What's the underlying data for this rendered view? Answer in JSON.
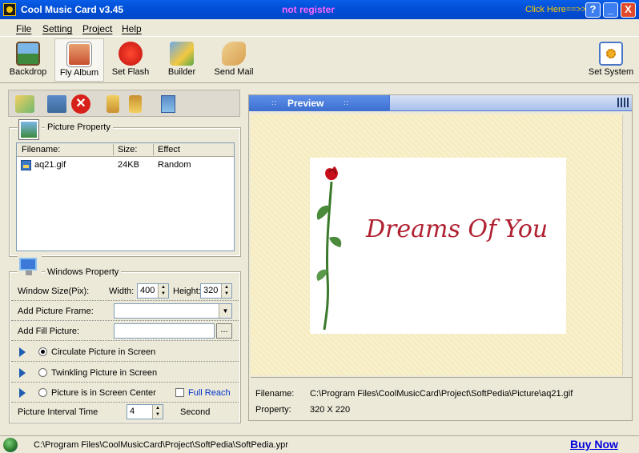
{
  "window": {
    "title": "Cool Music Card v3.45",
    "register_status": "not register",
    "click_here": "Click Here==>>",
    "help_btn": "?",
    "min_btn": "_",
    "close_btn": "X"
  },
  "menu": {
    "items": [
      {
        "label": "File"
      },
      {
        "label": "Setting"
      },
      {
        "label": "Project"
      },
      {
        "label": "Help"
      }
    ]
  },
  "toolbar": {
    "items": [
      {
        "label": "Backdrop",
        "icon": "landscape-picture-icon"
      },
      {
        "label": "Fly Album",
        "icon": "album-icon",
        "active": true
      },
      {
        "label": "Set Flash",
        "icon": "flash-icon"
      },
      {
        "label": "Builder",
        "icon": "builder-icon"
      },
      {
        "label": "Send Mail",
        "icon": "handshake-mail-icon"
      }
    ],
    "set_system_label": "Set System"
  },
  "picture_property": {
    "title": "Picture Property",
    "columns": [
      "Filename:",
      "Size:",
      "Effect"
    ],
    "rows": [
      {
        "filename": "aq21.gif",
        "size": "24KB",
        "effect": "Random"
      }
    ]
  },
  "windows_property": {
    "title": "Windows Property",
    "window_size_label": "Window Size(Pix):",
    "width_label": "Width:",
    "width_value": "400",
    "height_label": "Height:",
    "height_value": "320",
    "add_frame_label": "Add Picture Frame:",
    "add_fill_label": "Add Fill Picture:",
    "browse_label": "...",
    "option_circulate": "Circulate Picture in Screen",
    "option_twinkling": "Twinkling Picture in Screen",
    "option_center": "Picture is in Screen Center",
    "full_reach_label": "Full Reach",
    "interval_label": "Picture Interval Time",
    "interval_value": "4",
    "interval_unit": "Second"
  },
  "preview": {
    "tab_title": "Preview",
    "card_text": "Dreams Of You",
    "filename_label": "Filename:",
    "filename_value": "C:\\Program Files\\CoolMusicCard\\Project\\SoftPedia\\Picture\\aq21.gif",
    "property_label": "Property:",
    "property_value": "320 X 220"
  },
  "status": {
    "path": "C:\\Program Files\\CoolMusicCard\\Project\\SoftPedia\\SoftPedia.ypr",
    "buy_now": "Buy Now"
  },
  "colors": {
    "titlebar": "#0050d8",
    "card_text": "#b02030",
    "link": "#0000dd"
  }
}
